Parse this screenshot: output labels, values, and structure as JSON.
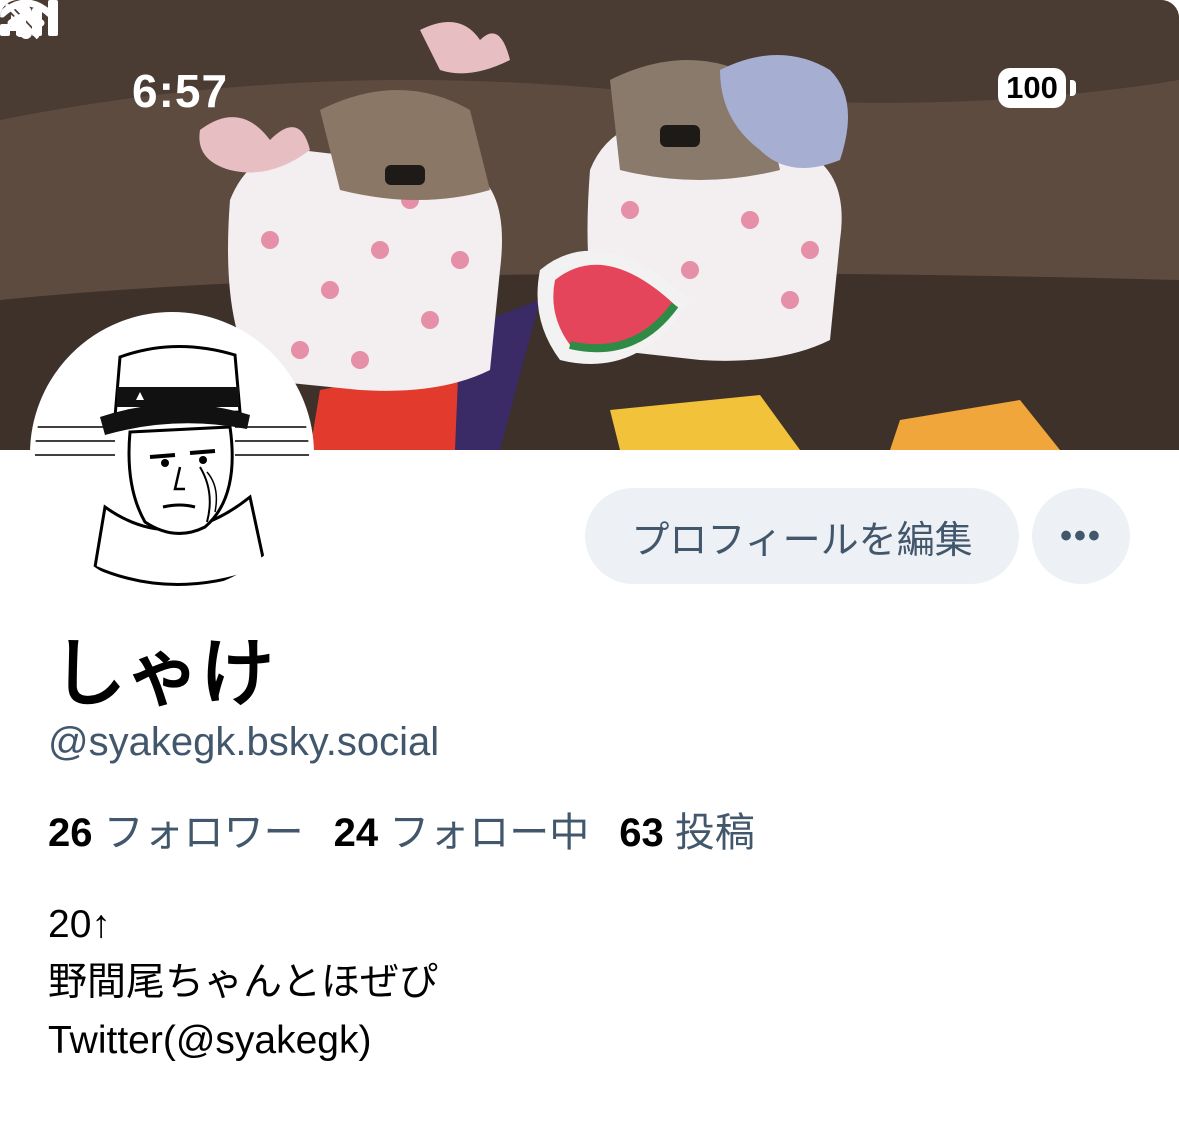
{
  "status_bar": {
    "time": "6:57",
    "battery": "100"
  },
  "profile": {
    "display_name": "しゃけ",
    "handle": "@syakegk.bsky.social",
    "edit_label": "プロフィールを編集",
    "more_label": "•••"
  },
  "stats": {
    "followers_count": "26",
    "followers_label": "フォロワー",
    "following_count": "24",
    "following_label": "フォロー中",
    "posts_count": "63",
    "posts_label": "投稿"
  },
  "bio": {
    "line1": "20↑",
    "line2": "野間尾ちゃんとほぜぴ",
    "line3": "Twitter(@syakegk)"
  }
}
